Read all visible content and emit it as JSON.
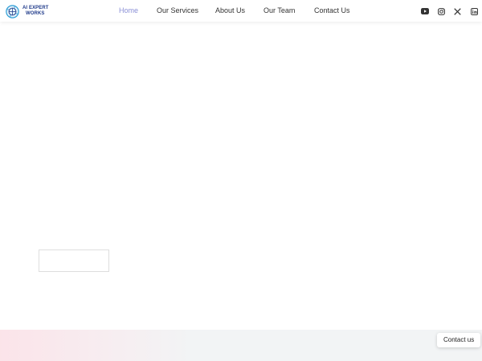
{
  "header": {
    "logo": {
      "line1": "AI EXPERT",
      "line2": "WORKS",
      "icon": "globe-logo-icon"
    },
    "nav": [
      {
        "label": "Home",
        "active": true
      },
      {
        "label": "Our Services",
        "active": false
      },
      {
        "label": "About Us",
        "active": false
      },
      {
        "label": "Our Team",
        "active": false
      },
      {
        "label": "Contact Us",
        "active": false
      }
    ],
    "social": [
      {
        "icon": "youtube-icon"
      },
      {
        "icon": "instagram-icon"
      },
      {
        "icon": "x-twitter-icon"
      },
      {
        "icon": "linkedin-icon"
      }
    ]
  },
  "main": {
    "ghost_button_label": ""
  },
  "floating": {
    "contact_label": "Contact us"
  },
  "colors": {
    "nav_active": "#8a8fd6",
    "nav_text": "#333333",
    "logo_text": "#1f3a8a",
    "footer_band": "#f2f4f5",
    "footer_tint": "#fce2e8"
  }
}
